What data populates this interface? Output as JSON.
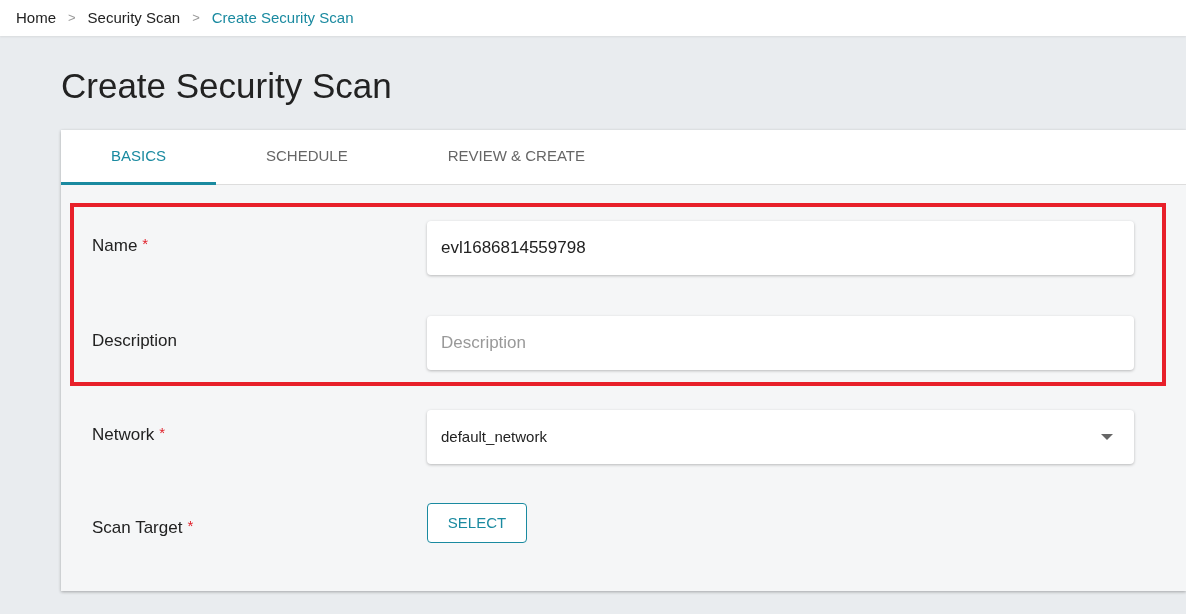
{
  "breadcrumb": [
    {
      "label": "Home",
      "current": false
    },
    {
      "label": "Security Scan",
      "current": false
    },
    {
      "label": "Create Security Scan",
      "current": true
    }
  ],
  "breadcrumb_separator": ">",
  "required_mark": "*",
  "page_title": "Create Security Scan",
  "tabs": [
    {
      "label": "BASICS",
      "selected": true
    },
    {
      "label": "SCHEDULE",
      "selected": false
    },
    {
      "label": "REVIEW & CREATE",
      "selected": false
    }
  ],
  "form": {
    "sections": [
      {
        "highlighted": true,
        "rows": [
          {
            "kind": "text",
            "label": "Name",
            "required": true,
            "value": "evl1686814559798"
          },
          {
            "kind": "text",
            "label": "Description",
            "required": false,
            "placeholder": "Description"
          }
        ]
      },
      {
        "highlighted": false,
        "rows": [
          {
            "kind": "select",
            "label": "Network",
            "required": true,
            "value": "default_network"
          },
          {
            "kind": "button",
            "label": "Scan Target",
            "required": true,
            "button": "SELECT"
          }
        ]
      }
    ]
  }
}
